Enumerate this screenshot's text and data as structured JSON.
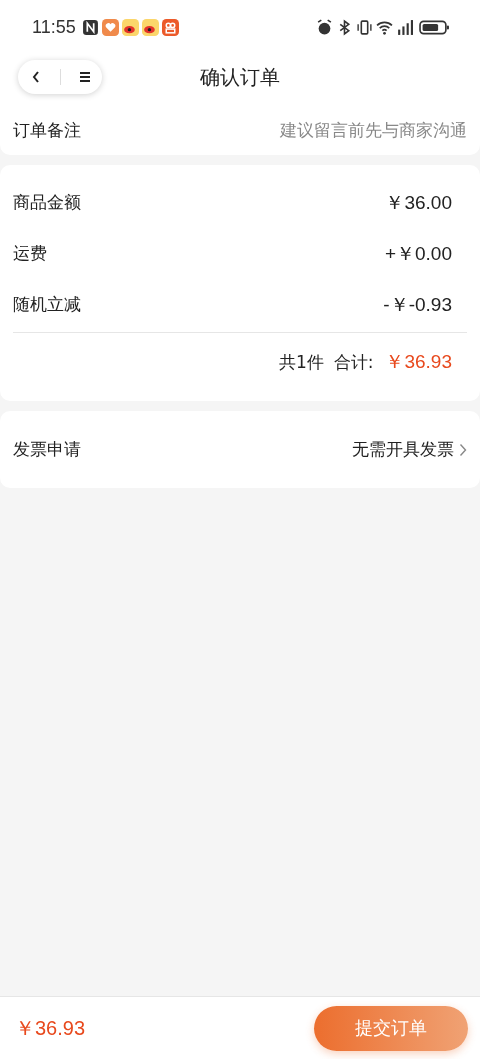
{
  "status_bar": {
    "time": "11:55"
  },
  "header": {
    "title": "确认订单"
  },
  "note": {
    "label": "订单备注",
    "placeholder": "建议留言前先与商家沟通"
  },
  "amounts": [
    {
      "label": "商品金额",
      "value": "￥36.00"
    },
    {
      "label": "运费",
      "value": "+￥0.00"
    },
    {
      "label": "随机立减",
      "value": "-￥-0.93"
    }
  ],
  "summary": {
    "count": "共1件",
    "total_label": "合计:",
    "total": "￥36.93"
  },
  "invoice": {
    "label": "发票申请",
    "value": "无需开具发票"
  },
  "footer": {
    "total": "￥36.93",
    "submit": "提交订单"
  }
}
